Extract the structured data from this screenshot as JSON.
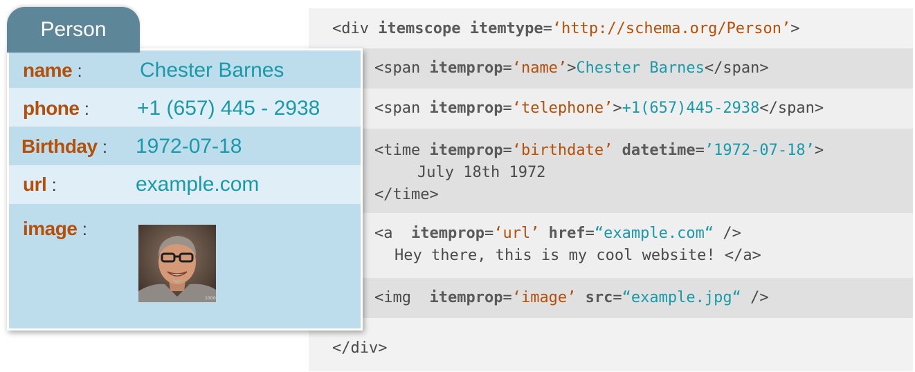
{
  "card": {
    "title": "Person",
    "fields": [
      {
        "label": "name",
        "colon": ":",
        "value": "Chester Barnes"
      },
      {
        "label": "phone",
        "colon": ":",
        "value": "+1 (657) 445 - 2938"
      },
      {
        "label": "Birthday",
        "colon": ":",
        "value": "1972-07-18"
      },
      {
        "label": "url",
        "colon": ":",
        "value": "example.com"
      },
      {
        "label": "image",
        "colon": ":"
      }
    ],
    "photo": {
      "alt": "portrait-photo",
      "watermark": "100004"
    }
  },
  "code": {
    "div_open": {
      "tag": "<div ",
      "a1": "itemscope ",
      "a2": "itemtype",
      "eq": "=",
      "str": "‘http://schema.org/Person’",
      "end": ">"
    },
    "span_name": {
      "tag": "<span ",
      "attr": "itemprop",
      "eq": "=",
      "str": "‘name’",
      "gt": ">",
      "val": "Chester Barnes",
      "close": "</span>"
    },
    "span_tel": {
      "tag": "<span ",
      "attr": "itemprop",
      "eq": "=",
      "str": "‘telephone’",
      "gt": ">",
      "val": "+1(657)445-2938",
      "close": "</span>"
    },
    "time": {
      "tag": "<time ",
      "attr": "itemprop",
      "eq": "=",
      "str": "‘birthdate’",
      "attr2": " datetime",
      "eq2": "=",
      "val": "’1972-07-18’",
      "gt": ">",
      "text": "July 18th 1972",
      "close": "</time>"
    },
    "a": {
      "tag": "<a  ",
      "attr": "itemprop",
      "eq": "=",
      "str": "‘url’",
      "attr2": " href",
      "eq2": "=",
      "val": "“example.com“",
      "end": " />",
      "text": "Hey there, this is my cool website! </a>"
    },
    "img": {
      "tag": "<img  ",
      "attr": "itemprop",
      "eq": "=",
      "str": "‘image’",
      "attr2": " src",
      "eq2": "=",
      "val": "“example.jpg“",
      "end": " />"
    },
    "div_close": "</div>"
  },
  "colors": {
    "accent_orange": "#b4500a",
    "accent_teal": "#1a9aa8",
    "card_tab": "#5d8799"
  }
}
